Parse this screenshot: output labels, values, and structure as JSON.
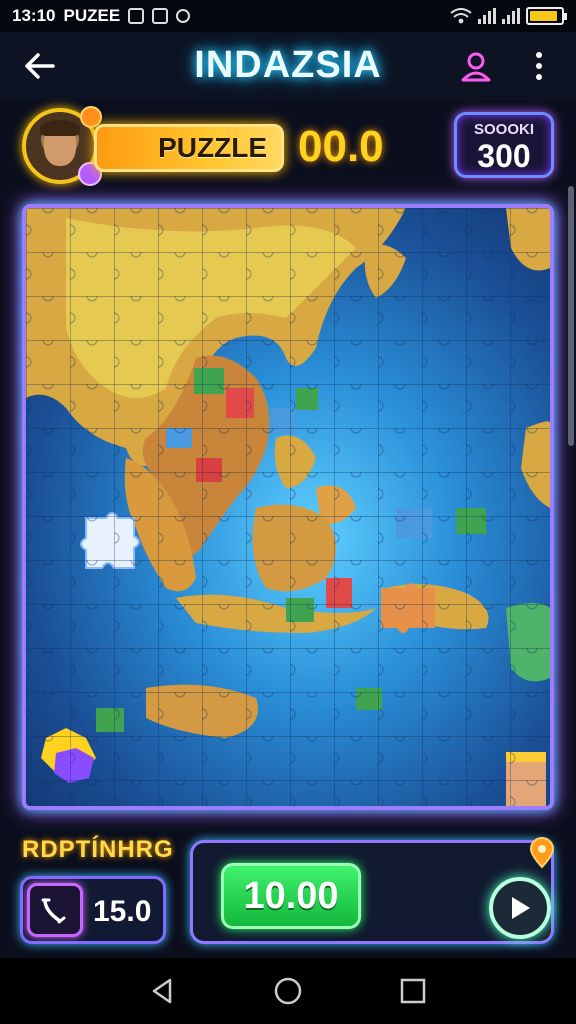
{
  "status_bar": {
    "time": "13:10",
    "app_name": "PUZEE",
    "battery_level": 0.9,
    "icons": [
      "gallery-icon",
      "notification-icon",
      "location-icon",
      "wifi-icon",
      "signal-icon",
      "battery-icon"
    ]
  },
  "header": {
    "title": "INDAZSIA",
    "back_icon": "arrow-left-icon",
    "profile_icon": "user-icon",
    "more_icon": "more-vertical-icon"
  },
  "info_row": {
    "puzzle_label": "PUZZLE",
    "progress_value": "00.0",
    "score_label": "SOOOKI",
    "score_value": "300"
  },
  "board": {
    "image": "jigsaw map of Southeast Asia"
  },
  "bottom": {
    "section_label": "RDPTÍNHRG",
    "timer_value": "15.0",
    "action_value": "10.00",
    "play_icon": "play-icon",
    "pin_icon": "map-pin-icon"
  },
  "navbar": {
    "icons": [
      "nav-back-icon",
      "nav-home-icon",
      "nav-recents-icon"
    ]
  },
  "colors": {
    "accent_cyan": "#27d7ff",
    "accent_purple": "#b44bff",
    "accent_yellow": "#ffd21f",
    "accent_green": "#28ff6a"
  }
}
